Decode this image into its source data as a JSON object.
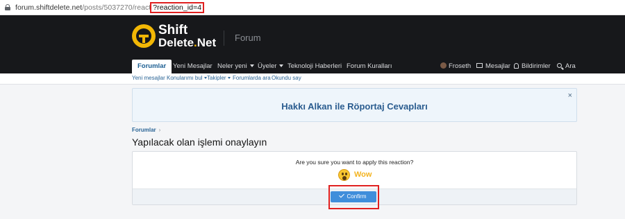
{
  "browser": {
    "url_host": "forum.shiftdelete.net",
    "url_path": "/posts/5037270/react",
    "url_query": "?reaction_id=4"
  },
  "header": {
    "logo_line1": "Shift",
    "logo_line2_main": "Delete",
    "logo_line2_dot": ".",
    "logo_line2_tld": "Net",
    "section": "Forum"
  },
  "nav": {
    "tabs": [
      "Forumlar",
      "Yeni Mesajlar",
      "Neler yeni",
      "Üyeler",
      "Teknoloji Haberleri",
      "Forum Kuralları"
    ],
    "user": "Froseth",
    "messages": "Mesajlar",
    "alerts": "Bildirimler",
    "search": "Ara"
  },
  "subnav": [
    "Yeni mesajlar",
    "Konularımı bul",
    "Takipler",
    "Forumlarda ara",
    "Okundu say"
  ],
  "notice": {
    "title": "Hakkı Alkan ile Röportaj Cevapları",
    "close": "×"
  },
  "breadcrumb": {
    "item": "Forumlar",
    "chevron": "›"
  },
  "page_title": "Yapılacak olan işlemi onaylayın",
  "confirm": {
    "question": "Are you sure you want to apply this reaction?",
    "reaction_label": "Wow",
    "button_label": "Confirm"
  },
  "colors": {
    "header_bg": "#17181b",
    "accent_blue": "#3f8edb",
    "logo_yellow": "#f2b705",
    "highlight_red": "#e02020"
  }
}
